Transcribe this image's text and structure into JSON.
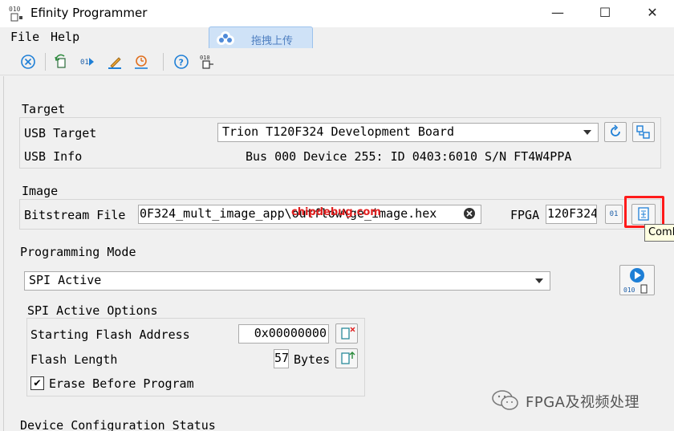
{
  "window": {
    "title": "Efinity Programmer",
    "minimize_glyph": "—",
    "maximize_glyph": "☐",
    "close_glyph": "✕",
    "app_icon_text": "010"
  },
  "menu": {
    "file": "File",
    "help": "Help"
  },
  "overlay": {
    "upload_label": "拖拽上传",
    "red_text": "chipdebug.com"
  },
  "toolbar": {
    "icons": [
      "stop-icon",
      "refresh-target-icon",
      "program-icon",
      "edit-icon",
      "timer-icon",
      "help-icon",
      "binary-icon"
    ]
  },
  "target": {
    "section_label": "Target",
    "usb_target_label": "USB Target",
    "usb_target_value": "Trion T120F324 Development Board",
    "usb_info_label": "USB Info",
    "usb_info_value": "Bus 000 Device 255: ID 0403:6010 S/N FT4W4PPA"
  },
  "image": {
    "section_label": "Image",
    "bitstream_label": "Bitstream File",
    "bitstream_value": "0F324_mult_image_app\\outflow\\ge_image.hex",
    "fpga_label": "FPGA",
    "fpga_value": "120F324",
    "fpga_btn_text": "01",
    "tooltip": "Comb"
  },
  "programming": {
    "section_label": "Programming Mode",
    "mode_value": "SPI Active",
    "options_label": "SPI Active Options",
    "start_addr_label": "Starting Flash Address",
    "start_addr_value": "0x00000000",
    "flash_len_label": "Flash Length",
    "flash_len_value": "57",
    "flash_len_unit": "Bytes",
    "erase_label": "Erase Before Program",
    "erase_checked": "✔",
    "start_btn_text": "010"
  },
  "status": {
    "section_label": "Device Configuration Status"
  },
  "watermark": {
    "text": "FPGA及视频处理"
  },
  "colors": {
    "accent": "#1e7fd6",
    "highlight": "#ff1a1a",
    "panel": "#f0f0f0"
  }
}
